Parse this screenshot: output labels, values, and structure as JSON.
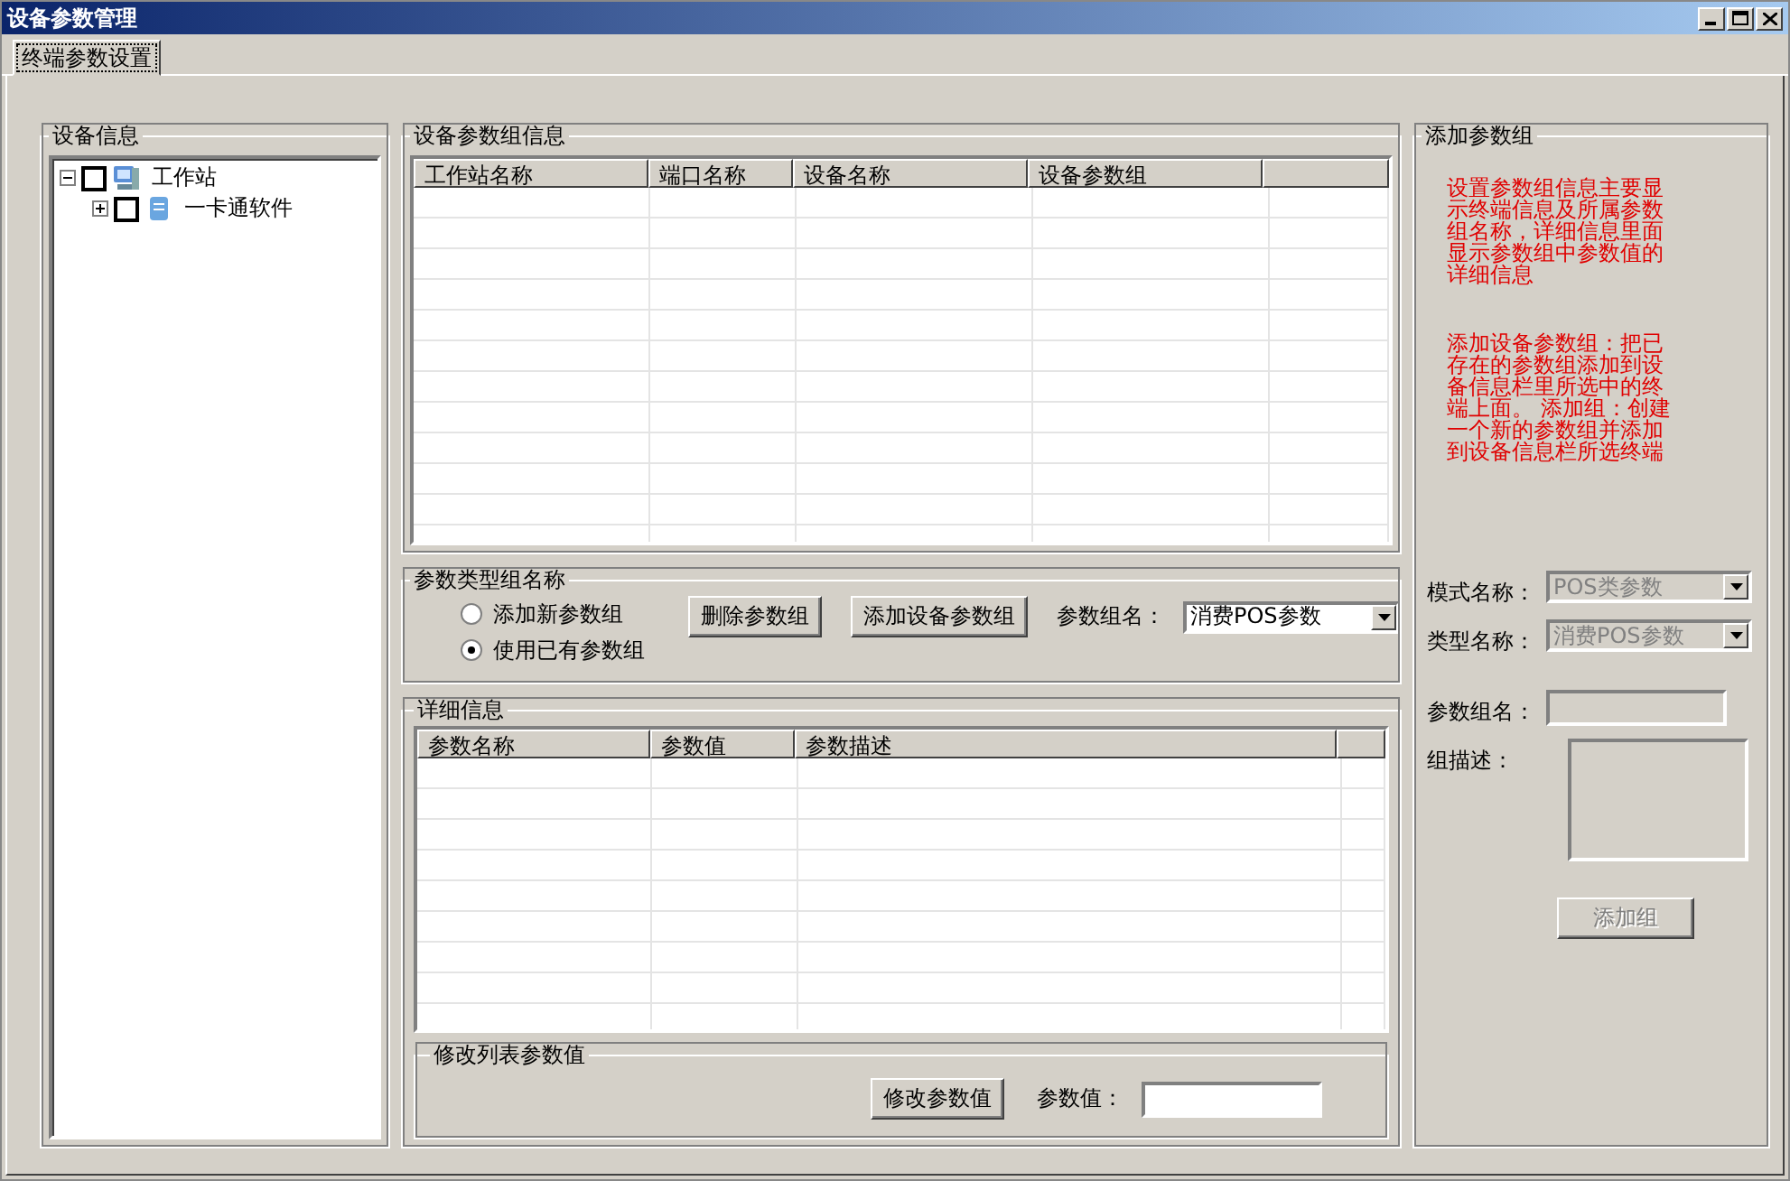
{
  "window": {
    "title": "设备参数管理"
  },
  "tabs": [
    {
      "label": "终端参数设置",
      "selected": true
    }
  ],
  "device_info": {
    "title": "设备信息",
    "tree": [
      {
        "label": "工作站",
        "checked": false,
        "expanded": true,
        "children": [
          {
            "label": "一卡通软件",
            "checked": false,
            "expanded": false
          }
        ]
      }
    ]
  },
  "group_info": {
    "title": "设备参数组信息",
    "columns": [
      "工作站名称",
      "端口名称",
      "设备名称",
      "设备参数组"
    ]
  },
  "param_type": {
    "title": "参数类型组名称",
    "options": [
      {
        "label": "添加新参数组",
        "selected": false
      },
      {
        "label": "使用已有参数组",
        "selected": true
      }
    ],
    "buttons": [
      "删除参数组",
      "添加设备参数组"
    ],
    "group_label": "参数组名：",
    "group_value": "消费POS参数"
  },
  "details": {
    "title": "详细信息",
    "columns": [
      "参数名称",
      "参数值",
      "参数描述"
    ],
    "modify": {
      "title": "修改列表参数值",
      "button": "修改参数值",
      "value_label": "参数值："
    }
  },
  "add_group": {
    "title": "添加参数组",
    "notes": [
      "设置参数组信息主要显示终端信息及所属参数组名称，详细信息里面显示参数组中参数值的详细信息",
      "添加设备参数组：把已存在的参数组添加到设备信息栏里所选中的终端上面。 添加组：创建一个新的参数组并添加到设备信息栏所选终端"
    ],
    "fields": [
      {
        "kind": "combo",
        "label": "模式名称：",
        "value": "POS类参数",
        "disabled": true
      },
      {
        "kind": "combo",
        "label": "类型名称：",
        "value": "消费POS参数",
        "disabled": true
      },
      {
        "kind": "text",
        "label": "参数组名："
      },
      {
        "kind": "textarea",
        "label": "组描述："
      }
    ],
    "button": {
      "label": "添加组",
      "disabled": true
    }
  }
}
